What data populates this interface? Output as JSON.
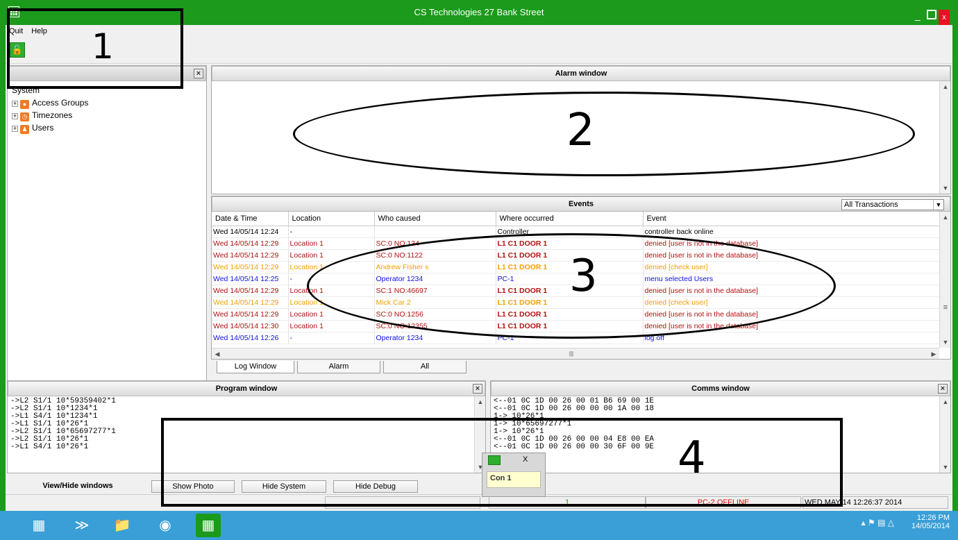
{
  "window": {
    "title": "CS Technologies 27 Bank Street",
    "close": "x"
  },
  "menu": {
    "quit": "Quit",
    "help": "Help"
  },
  "tree": {
    "root": "System",
    "items": [
      "Access Groups",
      "Timezones",
      "Users"
    ]
  },
  "alarm": {
    "title": "Alarm window"
  },
  "events": {
    "title": "Events",
    "filter": "All Transactions",
    "columns": [
      "Date & Time",
      "Location",
      "Who caused",
      "Where occurred",
      "Event"
    ],
    "rows": [
      {
        "dt": "Wed 14/05/14 12:24",
        "loc": "-",
        "who": "",
        "where": "Controller",
        "event": "controller back online",
        "color": "black"
      },
      {
        "dt": "Wed 14/05/14 12:29",
        "loc": "Location 1",
        "who": "SC:0 NO:134",
        "where": "L1 C1 DOOR 1",
        "event": "denied [user is not in the database]",
        "color": "red"
      },
      {
        "dt": "Wed 14/05/14 12:29",
        "loc": "Location 1",
        "who": "SC:0 NO:1122",
        "where": "L1 C1 DOOR 1",
        "event": "denied [user is not in the database]",
        "color": "red"
      },
      {
        "dt": "Wed 14/05/14 12:29",
        "loc": "Location 1",
        "who": "Andrew Fisher s",
        "where": "L1 C1 DOOR 1",
        "event": "denied [check user]",
        "color": "orange"
      },
      {
        "dt": "Wed 14/05/14 12:25",
        "loc": "-",
        "who": "Operator 1234",
        "where": "PC-1",
        "event": "menu selected Users",
        "color": "blue"
      },
      {
        "dt": "Wed 14/05/14 12:29",
        "loc": "Location 1",
        "who": "SC:1 NO:46697",
        "where": "L1 C1 DOOR 1",
        "event": "denied [user is not in the database]",
        "color": "red"
      },
      {
        "dt": "Wed 14/05/14 12:29",
        "loc": "Location 1",
        "who": "Mick Car 2",
        "where": "L1 C1 DOOR 1",
        "event": "denied [check user]",
        "color": "orange"
      },
      {
        "dt": "Wed 14/05/14 12:29",
        "loc": "Location 1",
        "who": "SC:0 NO:1256",
        "where": "L1 C1 DOOR 1",
        "event": "denied [user is not in the database]",
        "color": "red"
      },
      {
        "dt": "Wed 14/05/14 12:30",
        "loc": "Location 1",
        "who": "SC:0 NO:12355",
        "where": "L1 C1 DOOR 1",
        "event": "denied [user is not in the database]",
        "color": "red"
      },
      {
        "dt": "Wed 14/05/14 12:26",
        "loc": "-",
        "who": "Operator 1234",
        "where": "PC-1",
        "event": "log off",
        "color": "blue"
      }
    ]
  },
  "tabs": [
    "Log Window",
    "Alarm",
    "All"
  ],
  "program": {
    "title": "Program window",
    "lines": [
      "->L2 S1/1 10*59359402*1",
      "->L2 S1/1 10*1234*1",
      "->L1 S4/1 10*1234*1",
      "->L1 S1/1 10*26*1",
      "->L2 S1/1 10*65697277*1",
      "->L2 S1/1 10*26*1",
      "->L1 S4/1 10*26*1"
    ]
  },
  "comms": {
    "title": "Comms window",
    "lines": [
      "<--01 0C 1D 00 26 00 01 B6 69 00 1E",
      "<--01 0C 1D 00 26 00 00 00 1A 00 18",
      "1-> 10*26*1",
      "1-> 10*65697277*1",
      "1-> 10*26*1",
      "<--01 0C 1D 00 26 00 00 04 E8 00 EA",
      "<--01 0C 1D 00 26 00 00 30 6F 00 9E"
    ]
  },
  "bottom": {
    "view_hide": "View/Hide windows",
    "show_photo": "Show Photo",
    "hide_system": "Hide System",
    "hide_debug": "Hide Debug"
  },
  "status": {
    "count": "1",
    "pc": "PC-2 OFFLINE",
    "datetime": "WED MAY 14 12:26:37 2014"
  },
  "popup": {
    "label": "Con 1",
    "close": "X"
  },
  "taskbar": {
    "time": "12:26 PM",
    "date": "14/05/2014"
  },
  "annotations": {
    "n1": "1",
    "n2": "2",
    "n3": "3",
    "n4": "4"
  },
  "colors": {
    "title_bg": "#1b9a1b",
    "red": "#b01010",
    "orange": "#f0a000",
    "blue": "#1010e0",
    "taskbar": "#3a9fd6"
  }
}
